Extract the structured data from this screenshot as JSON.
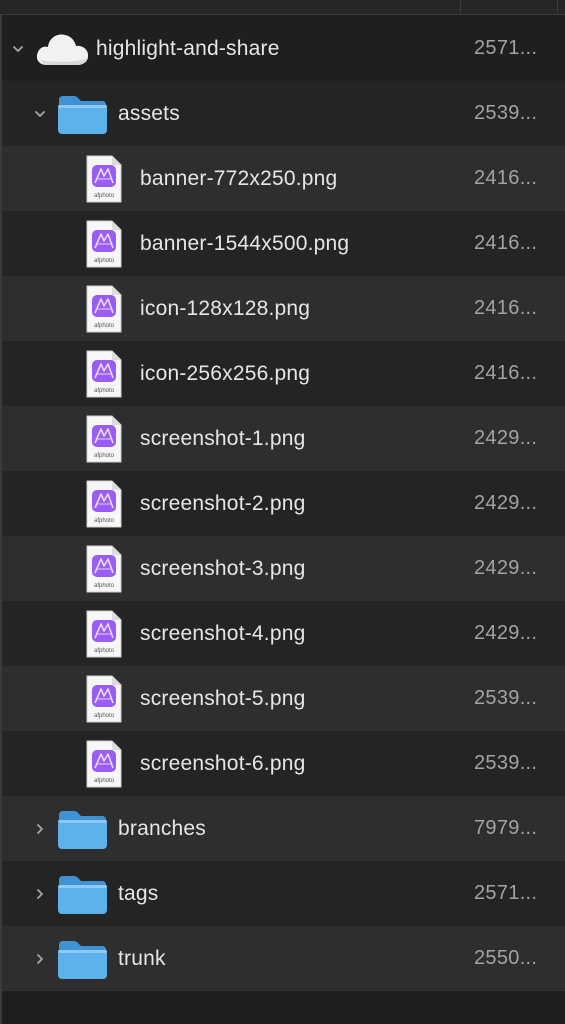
{
  "colors": {
    "background": "#1e1e1e",
    "row_dark": "#242424",
    "row_light": "#2e2e2e",
    "folder_blue": "#5db2ec",
    "affinity_purple": "#9b5cf5",
    "text_primary": "#e6e6e6",
    "text_secondary": "#a3a3a3"
  },
  "rows": [
    {
      "name": "highlight-and-share",
      "size": "2571...",
      "kind": "cloud",
      "depth": 0,
      "disclosure": "chevron-down"
    },
    {
      "name": "assets",
      "size": "2539...",
      "kind": "folder",
      "depth": 1,
      "disclosure": "chevron-down"
    },
    {
      "name": "banner-772x250.png",
      "size": "2416...",
      "kind": "afphoto-file",
      "icon_caption": "afphoto",
      "depth": 2
    },
    {
      "name": "banner-1544x500.png",
      "size": "2416...",
      "kind": "afphoto-file",
      "icon_caption": "afphoto",
      "depth": 2
    },
    {
      "name": "icon-128x128.png",
      "size": "2416...",
      "kind": "afphoto-file",
      "icon_caption": "afphoto",
      "depth": 2
    },
    {
      "name": "icon-256x256.png",
      "size": "2416...",
      "kind": "afphoto-file",
      "icon_caption": "afphoto",
      "depth": 2
    },
    {
      "name": "screenshot-1.png",
      "size": "2429...",
      "kind": "afphoto-file",
      "icon_caption": "afphoto",
      "depth": 2
    },
    {
      "name": "screenshot-2.png",
      "size": "2429...",
      "kind": "afphoto-file",
      "icon_caption": "afphoto",
      "depth": 2
    },
    {
      "name": "screenshot-3.png",
      "size": "2429...",
      "kind": "afphoto-file",
      "icon_caption": "afphoto",
      "depth": 2
    },
    {
      "name": "screenshot-4.png",
      "size": "2429...",
      "kind": "afphoto-file",
      "icon_caption": "afphoto",
      "depth": 2
    },
    {
      "name": "screenshot-5.png",
      "size": "2539...",
      "kind": "afphoto-file",
      "icon_caption": "afphoto",
      "depth": 2
    },
    {
      "name": "screenshot-6.png",
      "size": "2539...",
      "kind": "afphoto-file",
      "icon_caption": "afphoto",
      "depth": 2
    },
    {
      "name": "branches",
      "size": "7979...",
      "kind": "folder",
      "depth": 1,
      "disclosure": "chevron-right"
    },
    {
      "name": "tags",
      "size": "2571...",
      "kind": "folder",
      "depth": 1,
      "disclosure": "chevron-right"
    },
    {
      "name": "trunk",
      "size": "2550...",
      "kind": "folder",
      "depth": 1,
      "disclosure": "chevron-right"
    }
  ]
}
